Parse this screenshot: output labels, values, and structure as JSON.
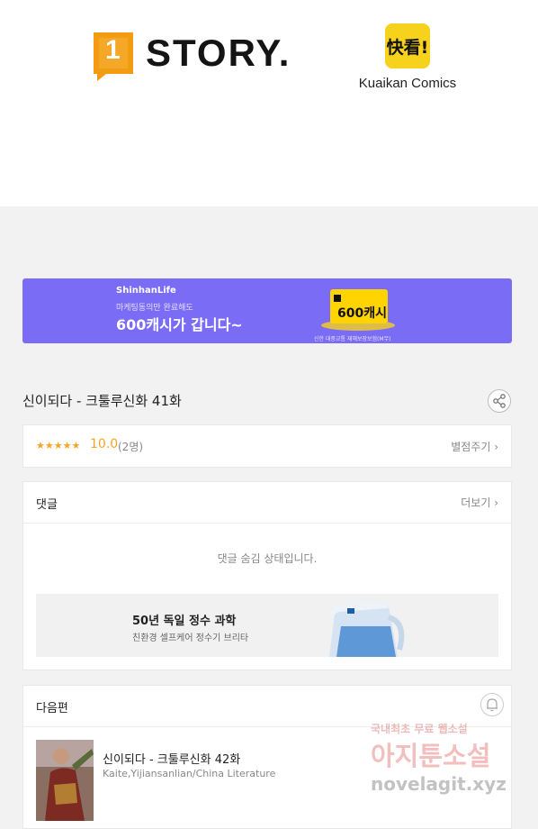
{
  "logos": {
    "onestory_mark": "1",
    "onestory_word": "STORY.",
    "kuaikan_badge": "快看!",
    "kuaikan_name": "Kuaikan Comics"
  },
  "banner": {
    "brand": "ShinhanLife",
    "sub": "마케팅동의만 완료해도",
    "headline": "600캐시가 갑니다~",
    "card_amount": "600캐시",
    "note": "신한 대중교통 재해보장보험(M무)"
  },
  "episode": {
    "title": "신이되다 - 크툴루신화 41화"
  },
  "rating": {
    "stars": "★★★★★",
    "score": "10.0",
    "count": "(2명)",
    "rate_link": "별점주기 ›"
  },
  "comments": {
    "title": "댓글",
    "more": "더보기 ›",
    "hidden_msg": "댓글 숨김 상태입니다."
  },
  "ad": {
    "title": "50년 독일 정수 과학",
    "sub": "친환경 셀프케어 정수기 브리타"
  },
  "next": {
    "title": "다음편",
    "episode": "신이되다 - 크툴루신화 42화",
    "authors": "Kaite,Yijiansanlian/China Literature"
  },
  "watermark": {
    "line1": "국내최초 무료 웹소설",
    "line2": "아지툰소설",
    "line3": "novelagit.xyz"
  },
  "colors": {
    "banner_bg": "#7b6cf6",
    "star": "#f5a623",
    "onestory_orange": "#f39c12",
    "kuaikan_yellow": "#f6d21d"
  }
}
